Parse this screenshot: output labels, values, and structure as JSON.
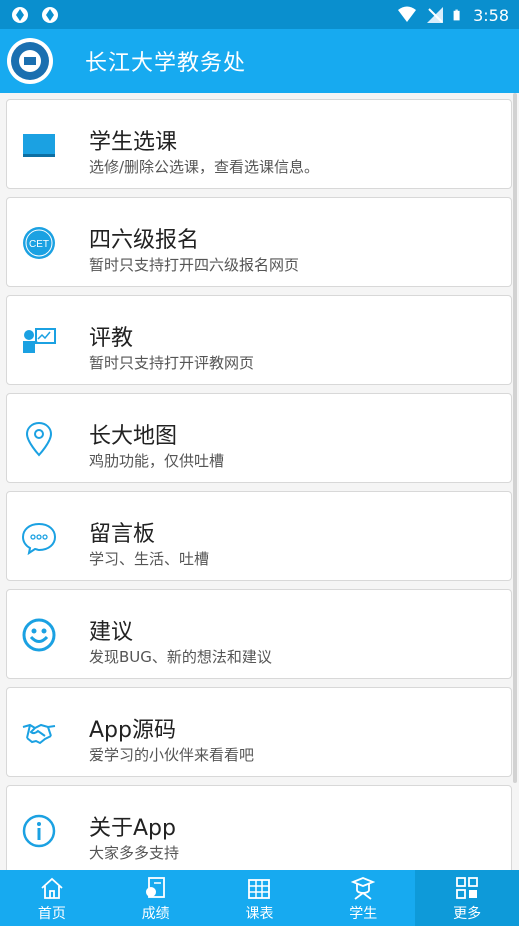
{
  "status_bar": {
    "time": "3:58"
  },
  "app_bar": {
    "title": "长江大学教务处"
  },
  "menu": [
    {
      "icon": "blackboard-icon",
      "title": "学生选课",
      "subtitle": "选修/删除公选课，查看选课信息。"
    },
    {
      "icon": "cet-icon",
      "icon_text": "CET",
      "title": "四六级报名",
      "subtitle": "暂时只支持打开四六级报名网页"
    },
    {
      "icon": "teacher-presentation-icon",
      "title": "评教",
      "subtitle": "暂时只支持打开评教网页"
    },
    {
      "icon": "map-pin-icon",
      "title": "长大地图",
      "subtitle": "鸡肋功能，仅供吐槽"
    },
    {
      "icon": "chat-bubble-icon",
      "title": "留言板",
      "subtitle": "学习、生活、吐槽"
    },
    {
      "icon": "smiley-icon",
      "title": "建议",
      "subtitle": "发现BUG、新的想法和建议"
    },
    {
      "icon": "handshake-icon",
      "title": "App源码",
      "subtitle": "爱学习的小伙伴来看看吧"
    },
    {
      "icon": "info-icon",
      "title": "关于App",
      "subtitle": "大家多多支持"
    }
  ],
  "tabs": [
    {
      "icon": "home-icon",
      "label": "首页"
    },
    {
      "icon": "grades-icon",
      "label": "成绩"
    },
    {
      "icon": "timetable-icon",
      "label": "课表"
    },
    {
      "icon": "student-icon",
      "label": "学生"
    },
    {
      "icon": "more-grid-icon",
      "label": "更多",
      "active": true
    }
  ],
  "colors": {
    "primary": "#17aaf0",
    "status_bar": "#0a8fce",
    "icon_blue": "#1ba1e2"
  }
}
